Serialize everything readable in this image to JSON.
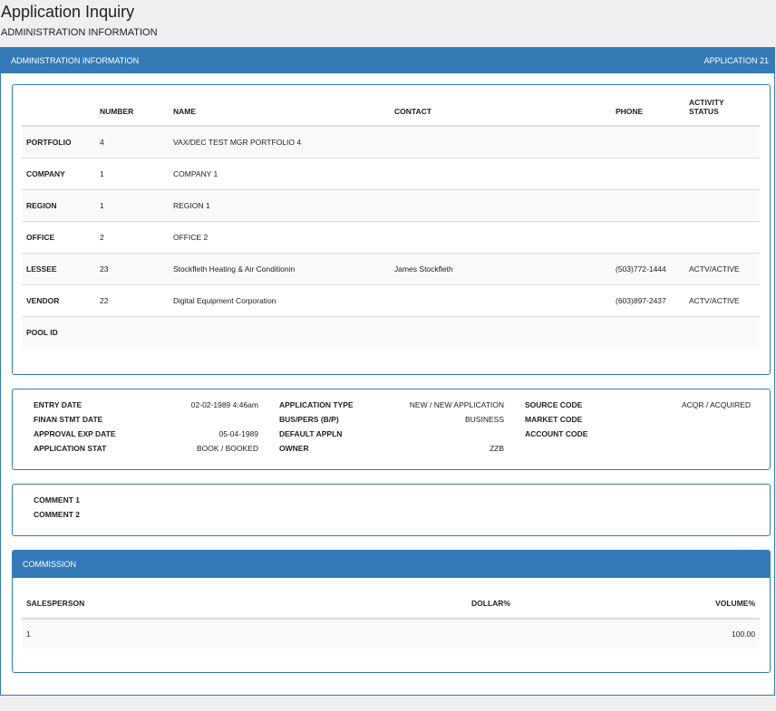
{
  "page": {
    "title": "Application Inquiry",
    "subtitle": "ADMINISTRATION INFORMATION"
  },
  "panel": {
    "title": "ADMINISTRATION INFORMATION",
    "application": "APPLICATION 21"
  },
  "admin_table": {
    "headers": [
      "",
      "NUMBER",
      "NAME",
      "CONTACT",
      "PHONE",
      "ACTIVITY STATUS"
    ],
    "rows": [
      {
        "label": "PORTFOLIO",
        "number": "4",
        "name": "VAX/DEC TEST MGR PORTFOLIO 4",
        "contact": "",
        "phone": "",
        "status": ""
      },
      {
        "label": "COMPANY",
        "number": "1",
        "name": "COMPANY 1",
        "contact": "",
        "phone": "",
        "status": ""
      },
      {
        "label": "REGION",
        "number": "1",
        "name": "REGION 1",
        "contact": "",
        "phone": "",
        "status": ""
      },
      {
        "label": "OFFICE",
        "number": "2",
        "name": "OFFICE 2",
        "contact": "",
        "phone": "",
        "status": ""
      },
      {
        "label": "LESSEE",
        "number": "23",
        "name": "Stockfleth Heating & Air Conditionin",
        "contact": "James Stockfleth",
        "phone": "(503)772-1444",
        "status": "ACTV/ACTIVE"
      },
      {
        "label": "VENDOR",
        "number": "22",
        "name": "Digital Equipment Corporation",
        "contact": "",
        "phone": "(603)897-2437",
        "status": "ACTV/ACTIVE"
      },
      {
        "label": "POOL ID",
        "number": "",
        "name": "",
        "contact": "",
        "phone": "",
        "status": ""
      }
    ]
  },
  "details": {
    "col1": [
      {
        "label": "ENTRY DATE",
        "value": "02-02-1989 4:46am"
      },
      {
        "label": "FINAN STMT DATE",
        "value": ""
      },
      {
        "label": "APPROVAL EXP DATE",
        "value": "05-04-1989"
      },
      {
        "label": "APPLICATION STAT",
        "value": "BOOK / BOOKED"
      }
    ],
    "col2": [
      {
        "label": "APPLICATION TYPE",
        "value": "NEW / NEW APPLICATION"
      },
      {
        "label": "BUS/PERS (B/P)",
        "value": "BUSINESS"
      },
      {
        "label": "DEFAULT APPLN",
        "value": ""
      },
      {
        "label": "OWNER",
        "value": "ZZB"
      }
    ],
    "col3": [
      {
        "label": "SOURCE CODE",
        "value": "ACQR / ACQUIRED"
      },
      {
        "label": "MARKET CODE",
        "value": ""
      },
      {
        "label": "ACCOUNT CODE",
        "value": ""
      }
    ]
  },
  "comments": {
    "comment1": "COMMENT 1",
    "comment2": "COMMENT 2"
  },
  "commission": {
    "title": "COMMISSION",
    "headers": {
      "salesperson": "SALESPERSON",
      "dollar": "DOLLAR%",
      "volume": "VOLUME%"
    },
    "rows": [
      {
        "salesperson": "1",
        "dollar": "",
        "volume": "100.00"
      }
    ]
  },
  "colors": {
    "header_bg": "#337ab7",
    "page_bg": "#efefef"
  }
}
